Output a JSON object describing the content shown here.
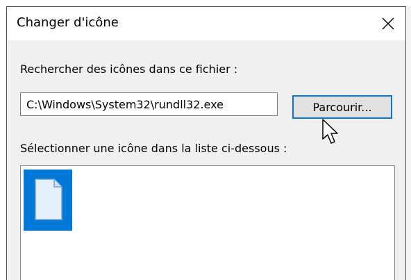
{
  "window": {
    "title": "Changer d'icône",
    "close_icon": "close-icon"
  },
  "search": {
    "label": "Rechercher des icônes dans ce fichier :",
    "path_value": "C:\\Windows\\System32\\rundll32.exe",
    "browse_label": "Parcourir..."
  },
  "list": {
    "label": "Sélectionner une icône dans la liste ci-dessous :",
    "items": [
      {
        "icon": "blank-document-icon",
        "selected": true
      }
    ]
  },
  "colors": {
    "selection": "#0078d7",
    "dialog_background": "#f0f0f0",
    "title_background": "#ffffff"
  }
}
